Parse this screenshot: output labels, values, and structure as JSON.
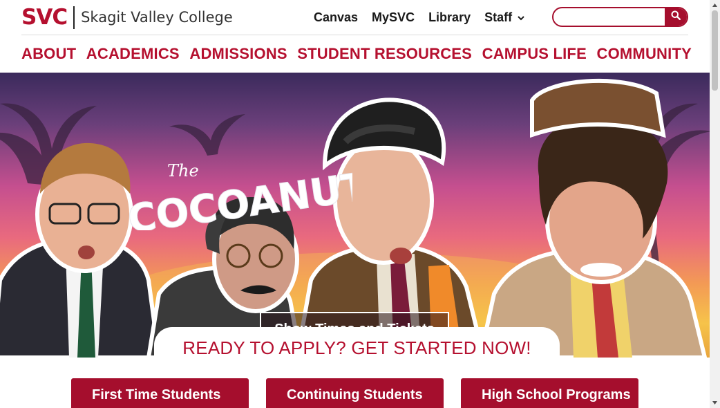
{
  "brand": {
    "short": "SVC",
    "name": "Skagit Valley College",
    "color": "#b5102f"
  },
  "utility_nav": [
    {
      "label": "Canvas"
    },
    {
      "label": "MySVC"
    },
    {
      "label": "Library"
    },
    {
      "label": "Staff",
      "has_dropdown": true
    }
  ],
  "search": {
    "placeholder": "",
    "value": "",
    "icon": "search-icon"
  },
  "main_nav": [
    "ABOUT",
    "ACADEMICS",
    "ADMISSIONS",
    "STUDENT RESOURCES",
    "CAMPUS LIFE",
    "COMMUNITY"
  ],
  "hero": {
    "title_small": "The",
    "title_large": "COCOANUTS",
    "cta": "Show Times and Tickets",
    "apply_banner": "READY TO APPLY? GET STARTED NOW!"
  },
  "audience_buttons": [
    "First Time Students",
    "Continuing Students",
    "High School Programs"
  ],
  "colors": {
    "accent": "#b5102f",
    "button": "#a50e2d"
  }
}
